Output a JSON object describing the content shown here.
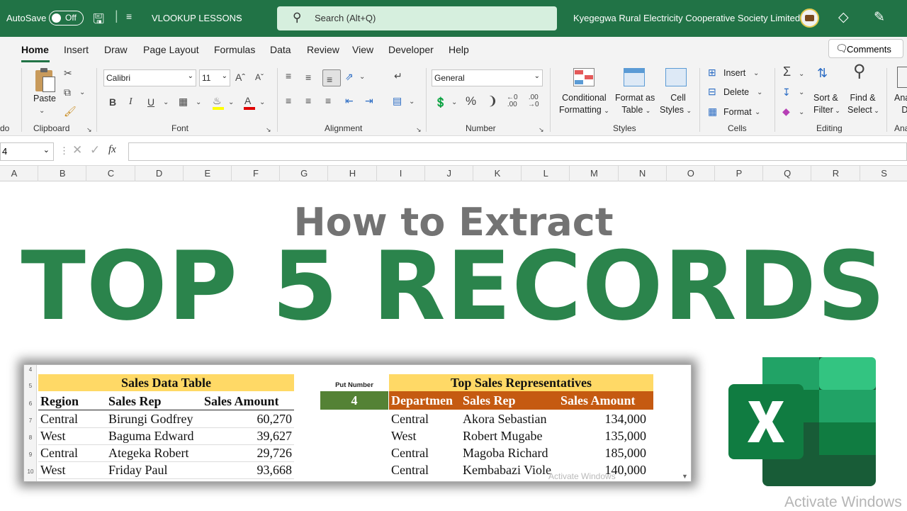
{
  "titlebar": {
    "autosave_label": "AutoSave",
    "autosave_state": "Off",
    "file_name": "VLOOKUP LESSONS",
    "search_placeholder": "Search (Alt+Q)",
    "org_name": "Kyegegwa Rural Electricity Cooperative Society Limited"
  },
  "menu": {
    "tabs": [
      "Home",
      "Insert",
      "Draw",
      "Page Layout",
      "Formulas",
      "Data",
      "Review",
      "View",
      "Developer",
      "Help"
    ],
    "active": "Home",
    "comments_label": "Comments"
  },
  "ribbon": {
    "undo_label": "do",
    "paste_label": "Paste",
    "clipboard_label": "Clipboard",
    "font_name": "Calibri",
    "font_size": "11",
    "font_label": "Font",
    "alignment_label": "Alignment",
    "number_format": "General",
    "number_label": "Number",
    "conditional_formatting": [
      "Conditional",
      "Formatting"
    ],
    "format_as_table": [
      "Format as",
      "Table"
    ],
    "cell_styles": [
      "Cell",
      "Styles"
    ],
    "styles_label": "Styles",
    "insert_label": "Insert",
    "delete_label": "Delete",
    "format_label": "Format",
    "cells_label": "Cells",
    "sort_filter": [
      "Sort &",
      "Filter"
    ],
    "find_select": [
      "Find &",
      "Select"
    ],
    "editing_label": "Editing",
    "analyze_label": [
      "Ana",
      "D"
    ],
    "analyze_group": "Ana"
  },
  "formula_bar": {
    "name_box": "4",
    "fx": "fx",
    "formula": ""
  },
  "columns": [
    "A",
    "B",
    "C",
    "D",
    "E",
    "F",
    "G",
    "H",
    "I",
    "J",
    "K",
    "L",
    "M",
    "N",
    "O",
    "P",
    "Q",
    "R",
    "S"
  ],
  "headline": {
    "line1": "How to Extract",
    "line2": "TOP 5 RECORDS"
  },
  "sheet": {
    "row_numbers": [
      "4",
      "5",
      "6",
      "7",
      "8",
      "9",
      "10"
    ],
    "sales_table_title": "Sales Data Table",
    "sales_headers": [
      "Region",
      "Sales Rep",
      "Sales Amount"
    ],
    "sales_rows": [
      [
        "Central",
        "Birungi Godfrey",
        "60,270"
      ],
      [
        "West",
        "Baguma Edward",
        "39,627"
      ],
      [
        "Central",
        "Ategeka Robert",
        "29,726"
      ],
      [
        "West",
        "Friday Paul",
        "93,668"
      ]
    ],
    "put_number_label": "Put Number",
    "put_number_value": "4",
    "top_title": "Top Sales Representatives",
    "top_headers": [
      "Departmen",
      "Sales Rep",
      "Sales Amount"
    ],
    "top_rows": [
      [
        "Central",
        "Akora Sebastian",
        "134,000"
      ],
      [
        "West",
        "Robert Mugabe",
        "135,000"
      ],
      [
        "Central",
        "Magoba Richard",
        "185,000"
      ],
      [
        "Central",
        "Kembabazi Viole",
        "140,000"
      ]
    ],
    "inner_watermark": "Activate Windows"
  },
  "watermark": "Activate Windows",
  "colors": {
    "excel_green": "#217346",
    "headline_green": "#2b844c",
    "headline_grey": "#737373",
    "title_yellow": "#ffd966",
    "put_number_green": "#548235",
    "header_orange": "#c55a11"
  }
}
